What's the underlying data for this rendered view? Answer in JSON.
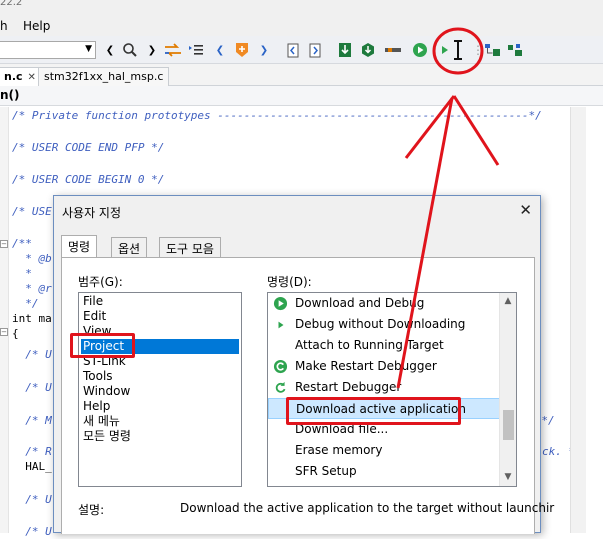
{
  "window": {
    "title_fragment": "22.2"
  },
  "menubar": {
    "items": [
      "h",
      "Help"
    ]
  },
  "tabs": [
    {
      "label": "n.c"
    },
    {
      "label": "stm32f1xx_hal_msp.c"
    }
  ],
  "breadcrumb": "n()",
  "code": {
    "lines": [
      "/* Private function prototypes -----------------------------------------------*/",
      "/* USER CODE END PFP */",
      "/* USER CODE BEGIN 0 */",
      "/* USE",
      "/**",
      "  * @b",
      "  *",
      "  * @r",
      "  */",
      "int ma",
      "{",
      "  /* U",
      "  /* U",
      "  /* M",
      "  /* R",
      "  HAL_",
      "  /* U",
      "  /* U"
    ],
    "right_fragments": [
      "----------------------------*/",
      "ck. */"
    ]
  },
  "dialog": {
    "title": "사용자 지정",
    "close": "✕",
    "tabs": [
      "명령",
      "옵션",
      "도구 모음"
    ],
    "category_label": "범주(G):",
    "command_label": "명령(D):",
    "categories": [
      "File",
      "Edit",
      "View",
      "Project",
      "ST-Link",
      "Tools",
      "Window",
      "Help",
      "새 메뉴",
      "모든 명령"
    ],
    "selected_category": "Project",
    "commands": [
      {
        "label": "Download and Debug",
        "icon": "debug-play-icon"
      },
      {
        "label": "Debug without Downloading",
        "icon": "debug-small-play-icon"
      },
      {
        "label": "Attach to Running Target",
        "icon": ""
      },
      {
        "label": "Make  Restart Debugger",
        "icon": "make-restart-icon"
      },
      {
        "label": "Restart Debugger",
        "icon": "restart-icon"
      },
      {
        "label": "Download active application",
        "icon": ""
      },
      {
        "label": "Download file...",
        "icon": ""
      },
      {
        "label": "Erase memory",
        "icon": ""
      },
      {
        "label": "SFR Setup",
        "icon": ""
      }
    ],
    "selected_command": "Download active application",
    "description_label": "설명:",
    "description": "Download the active application to the target without launchir"
  },
  "colors": {
    "annotation": "#e0141c",
    "selection": "#0078d7",
    "comment": "#3f5fbf",
    "accent_green": "#2ea44f"
  }
}
